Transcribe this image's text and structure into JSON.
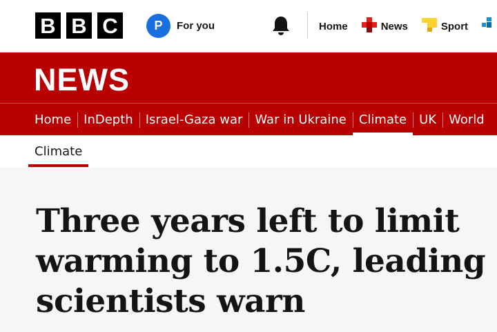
{
  "header": {
    "logo_letters": [
      "B",
      "B",
      "C"
    ],
    "for_you": {
      "avatar_letter": "P",
      "label": "For you"
    },
    "nav": [
      {
        "label": "Home",
        "icon": "none"
      },
      {
        "label": "News",
        "icon": "news-icon"
      },
      {
        "label": "Sport",
        "icon": "sport-icon"
      }
    ]
  },
  "masthead": {
    "title": "NEWS",
    "sections": [
      {
        "label": "Home",
        "active": false
      },
      {
        "label": "InDepth",
        "active": false
      },
      {
        "label": "Israel-Gaza war",
        "active": false
      },
      {
        "label": "War in Ukraine",
        "active": false
      },
      {
        "label": "Climate",
        "active": true
      },
      {
        "label": "UK",
        "active": false
      },
      {
        "label": "World",
        "active": false
      }
    ]
  },
  "subnav": {
    "active_label": "Climate"
  },
  "article": {
    "headline": "Three years left to limit warming to 1.5C, leading scientists warn"
  },
  "colors": {
    "brand_red": "#b80000",
    "news_icon_red": "#e0211b",
    "sport_icon_yellow": "#ffd230",
    "avatar_blue": "#1a6fe0",
    "weather_blue": "#1a8fd6"
  }
}
